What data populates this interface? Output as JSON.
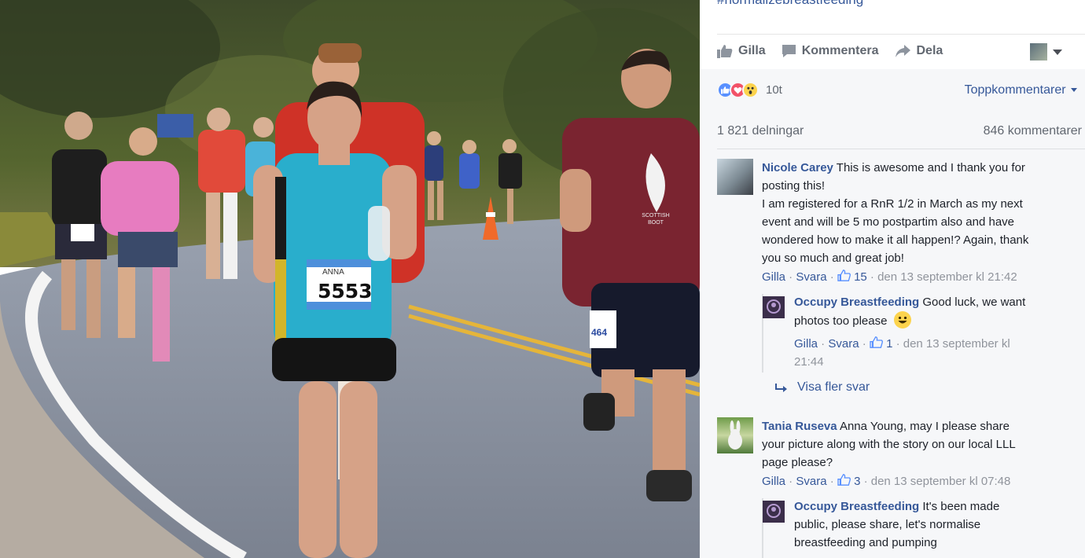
{
  "post": {
    "hashtag": "#normalizebreastfeeding",
    "bib_name": "ANNA",
    "bib_number": "5553",
    "runner_bib": "464",
    "shirt_text": "SCOTTISH BOOT"
  },
  "actions": {
    "like": "Gilla",
    "comment": "Kommentera",
    "share": "Dela"
  },
  "reactions": {
    "count": "10t",
    "sort_label": "Toppkommentarer",
    "shares": "1 821 delningar",
    "comments": "846 kommentarer"
  },
  "comments": [
    {
      "name": "Nicole Carey",
      "text_line1": "This is awesome and I thank you for",
      "text_line2": "posting this!",
      "text_line3": "I am registered for a RnR 1/2 in March as my next",
      "text_line4": "event and will be 5 mo postpartim also and have",
      "text_line5": "wondered how to make it all happen!? Again, thank",
      "text_line6": "you so much and great job!",
      "like": "Gilla",
      "sep": " · ",
      "reply": "Svara",
      "likes": "15",
      "time": " · den 13 september kl 21:42"
    },
    {
      "name": "Tania Ruseva",
      "text_line1": "Anna Young, may I please share",
      "text_line2": "your picture along with the story on our local LLL",
      "text_line3": "page please?",
      "like": "Gilla",
      "sep": " · ",
      "reply": "Svara",
      "likes": "3",
      "time": " · den 13 september kl 07:48"
    }
  ],
  "replies": [
    {
      "name": "Occupy Breastfeeding",
      "text_line1": "Good luck, we want",
      "text_line2": "photos too please",
      "like": "Gilla",
      "sep": " · ",
      "reply": "Svara",
      "likes": "1",
      "time_line1": " · den 13 september kl",
      "time_line2": "21:44"
    },
    {
      "name": "Occupy Breastfeeding",
      "text_line1": "It's been made",
      "text_line2": "public, please share, let's normalise",
      "text_line3": "breastfeeding and pumping"
    }
  ],
  "more_replies": "Visa fler svar",
  "colors": {
    "link": "#365899",
    "meta": "#90949c",
    "like_blue": "#5890ff",
    "love_red": "#f25268"
  }
}
